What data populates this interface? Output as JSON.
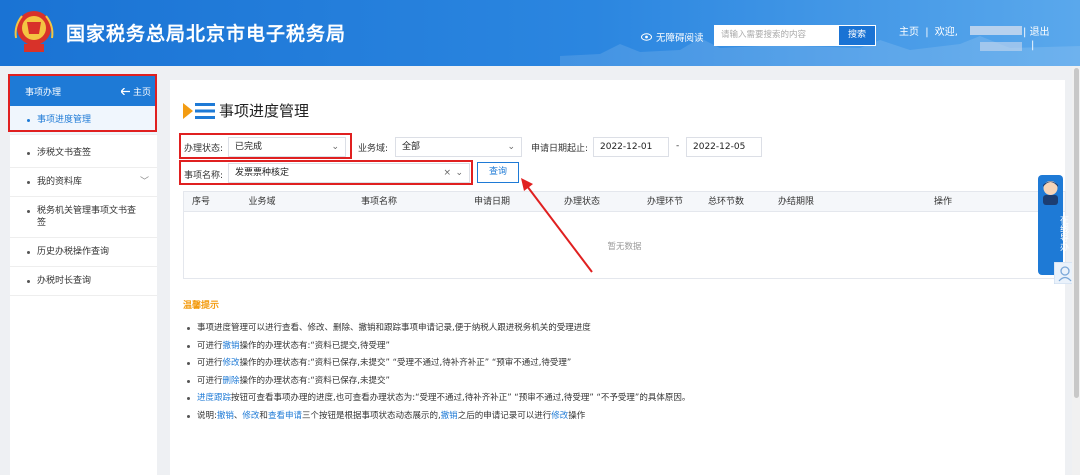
{
  "header": {
    "site_title": "国家税务总局北京市电子税务局",
    "accessibility": "无障碍阅读",
    "search_placeholder": "请输入需要搜索的内容",
    "search_button": "搜索",
    "home": "主页",
    "welcome": "欢迎,",
    "logout": "退出",
    "sep": "|"
  },
  "sidebar": {
    "head_label": "事项办理",
    "home_link": "主页",
    "items": [
      {
        "label": "事项进度管理"
      },
      {
        "label": "涉税文书查签"
      },
      {
        "label": "我的资料库"
      },
      {
        "label": "税务机关管理事项文书查签"
      },
      {
        "label": "历史办税操作查询"
      },
      {
        "label": "办税时长查询"
      }
    ]
  },
  "main": {
    "page_title": "事项进度管理",
    "filters": {
      "status_label": "办理状态:",
      "status_value": "已完成",
      "domain_label": "业务域:",
      "domain_value": "全部",
      "date_label": "申请日期起止:",
      "date_from": "2022-12-01",
      "date_sep": "-",
      "date_to": "2022-12-05",
      "item_label": "事项名称:",
      "item_value": "发票票种核定",
      "clear": "×",
      "query_button": "查询"
    },
    "table": {
      "columns": [
        "序号",
        "业务域",
        "事项名称",
        "申请日期",
        "办理状态",
        "办理环节",
        "总环节数",
        "办结期限",
        "操作"
      ],
      "empty_text": "暂无数据"
    },
    "tips": {
      "title": "温馨提示",
      "lines": [
        {
          "parts": [
            {
              "t": "事项进度管理可以进行查看、修改、删除、撤销和跟踪事项申请记录,便于纳税人跟进税务机关的受理进度"
            }
          ]
        },
        {
          "parts": [
            {
              "t": "可进行"
            },
            {
              "t": "撤销",
              "link": true
            },
            {
              "t": "操作的办理状态有:“资料已提交,待受理”"
            }
          ]
        },
        {
          "parts": [
            {
              "t": "可进行"
            },
            {
              "t": "修改",
              "link": true
            },
            {
              "t": "操作的办理状态有:“资料已保存,未提交” “受理不通过,待补齐补正” “预审不通过,待受理”"
            }
          ]
        },
        {
          "parts": [
            {
              "t": "可进行"
            },
            {
              "t": "删除",
              "link": true
            },
            {
              "t": "操作的办理状态有:“资料已保存,未提交”"
            }
          ]
        },
        {
          "parts": [
            {
              "t": "进度跟踪",
              "link": true
            },
            {
              "t": "按钮可查看事项办理的进度,也可查看办理状态为:“受理不通过,待补齐补正” “预审不通过,待受理” “不予受理”的具体原因。"
            }
          ]
        },
        {
          "parts": [
            {
              "t": "说明:"
            },
            {
              "t": "撤销",
              "link": true
            },
            {
              "t": "、"
            },
            {
              "t": "修改",
              "link": true
            },
            {
              "t": "和"
            },
            {
              "t": "查看申请",
              "link": true
            },
            {
              "t": "三个按钮是根据事项状态动态展示的,"
            },
            {
              "t": "撤销",
              "link": true
            },
            {
              "t": "之后的申请记录可以进行"
            },
            {
              "t": "修改",
              "link": true
            },
            {
              "t": "操作"
            }
          ]
        }
      ]
    }
  },
  "guide": {
    "label": "在线导办"
  },
  "colors": {
    "primary": "#1e7ad6",
    "highlight": "#e02020",
    "tip_title": "#f39c12"
  }
}
